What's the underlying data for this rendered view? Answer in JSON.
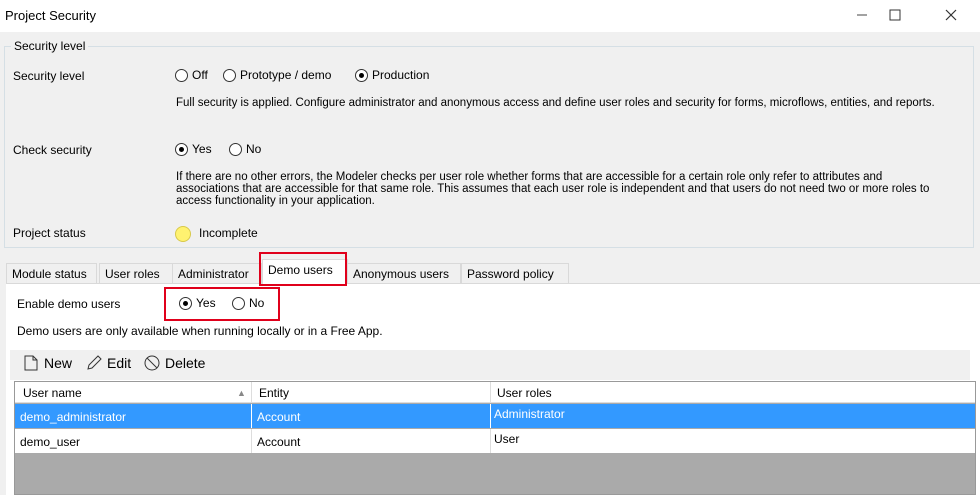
{
  "window": {
    "title": "Project Security"
  },
  "security": {
    "group_title": "Security level",
    "level_label": "Security level",
    "level_options": [
      "Off",
      "Prototype / demo",
      "Production"
    ],
    "level_selected": "Production",
    "level_desc": "Full security is applied. Configure administrator and anonymous access and define user roles and security for forms, microflows, entities, and reports.",
    "check_label": "Check security",
    "check_options": [
      "Yes",
      "No"
    ],
    "check_selected": "Yes",
    "check_desc": "If there are no other errors, the Modeler checks per user role whether forms that are accessible for a certain role only refer to attributes and associations that are accessible for that same role. This assumes that each user role is independent and that users do not need two or more roles to access functionality in your application.",
    "status_label": "Project status",
    "status_value": "Incomplete"
  },
  "tabs": [
    "Module status",
    "User roles",
    "Administrator",
    "Demo users",
    "Anonymous users",
    "Password policy"
  ],
  "active_tab": "Demo users",
  "demo": {
    "enable_label": "Enable demo users",
    "enable_options": [
      "Yes",
      "No"
    ],
    "enable_selected": "Yes",
    "note": "Demo users are only available when running locally or in a Free App."
  },
  "toolbar": {
    "new": "New",
    "edit": "Edit",
    "delete": "Delete"
  },
  "table": {
    "columns": [
      "User name",
      "Entity",
      "User roles"
    ],
    "rows": [
      {
        "user": "demo_administrator",
        "entity": "Account",
        "roles": "Administrator",
        "selected": true
      },
      {
        "user": "demo_user",
        "entity": "Account",
        "roles": "User",
        "selected": false
      }
    ]
  },
  "colors": {
    "selection": "#3399ff",
    "highlight": "#e0001b",
    "status_dot": "#fff270"
  }
}
